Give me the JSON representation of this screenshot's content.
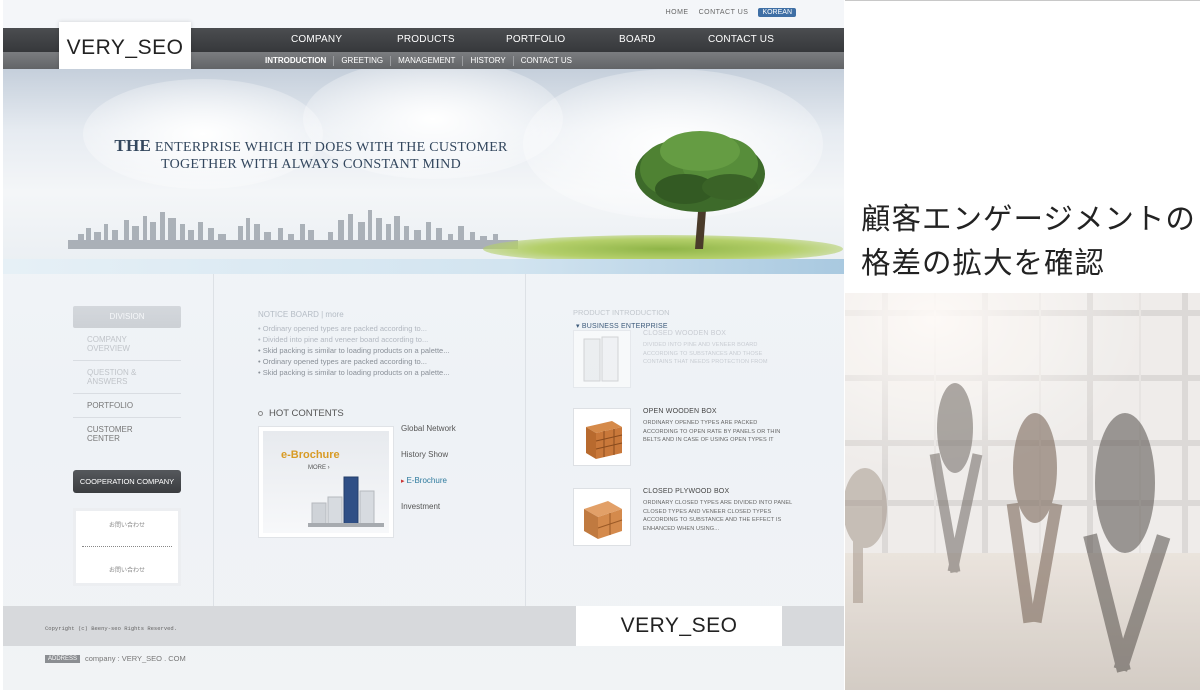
{
  "site": {
    "util_links": [
      "HOME",
      "CONTACT US"
    ],
    "lang_badge": "KOREAN",
    "logo_text": "VERY_SEO",
    "main_menu": [
      "COMPANY",
      "PRODUCTS",
      "PORTFOLIO",
      "BOARD",
      "CONTACT US"
    ],
    "sub_menu": [
      "INTRODUCTION",
      "GREETING",
      "MANAGEMENT",
      "HISTORY",
      "CONTACT US"
    ],
    "hero": {
      "line1_big": "THE",
      "line1_rest": " ENTERPRISE WHICH IT DOES WITH THE CUSTOMER",
      "line2": "TOGETHER WITH ALWAYS CONSTANT MIND"
    },
    "side_menu": {
      "head": "DIVISION",
      "items": [
        "COMPANY OVERVIEW",
        "QUESTION & ANSWERS",
        "PORTFOLIO",
        "CUSTOMER CENTER"
      ],
      "cooperation_button": "COOPERATION COMPANY",
      "inquiry_1": "お問い合わせ",
      "inquiry_2": "お問い合わせ"
    },
    "notice": {
      "heading": "NOTICE BOARD  |  more",
      "items": [
        "• Ordinary opened types are packed according to...",
        "• Divided into pine and veneer board according to...",
        "• Skid packing is similar to loading products on a palette...",
        "• Ordinary opened types are packed according to...",
        "• Skid packing is similar to loading products on a palette..."
      ]
    },
    "hot_contents": {
      "heading": "HOT CONTENTS",
      "banner_title": "e-Brochure",
      "banner_more": "MORE ›",
      "links": [
        "Global Network",
        "History Show",
        "E-Brochure",
        "Investment"
      ]
    },
    "products": {
      "heading": "PRODUCT INTRODUCTION",
      "items": [
        {
          "name": "CLOSED WOODEN BOX",
          "desc": "DIVIDED INTO PINE AND VENEER BOARD ACCORDING TO SUBSTANCES AND THOSE CONTAINS THAT NEEDS PROTECTION FROM"
        },
        {
          "name": "OPEN WOODEN BOX",
          "desc": "ORDINARY OPENED TYPES ARE PACKED ACCORDING TO OPEN RATE BY PANELS OR THIN BELTS AND IN CASE OF USING OPEN TYPES IT"
        },
        {
          "name": "CLOSED PLYWOOD BOX",
          "desc": "ORDINARY CLOSED TYPES ARE DIVIDED INTO PANEL CLOSED TYPES AND VENEER CLOSED TYPES ACCORDING TO SUBSTANCE AND THE EFFECT IS ENHANCED WHEN USING..."
        }
      ]
    },
    "business_heading": "BUSINESS ENTERPRISE",
    "copyright": "Copyright (c) Beeny-seo Rights Reserved.",
    "footer_logo_text": "VERY_SEO",
    "address_tag": "ADDRESS",
    "address": "company : VERY_SEO . COM"
  },
  "promo": {
    "heading_line1": "顧客エンゲージメントの",
    "heading_line2": "格差の拡大を確認"
  },
  "colors": {
    "nav_dark": "#3f4144",
    "accent_blue": "#3f6fa5",
    "brochure_orange": "#d89b25",
    "link_teal": "#2e7a9e"
  }
}
